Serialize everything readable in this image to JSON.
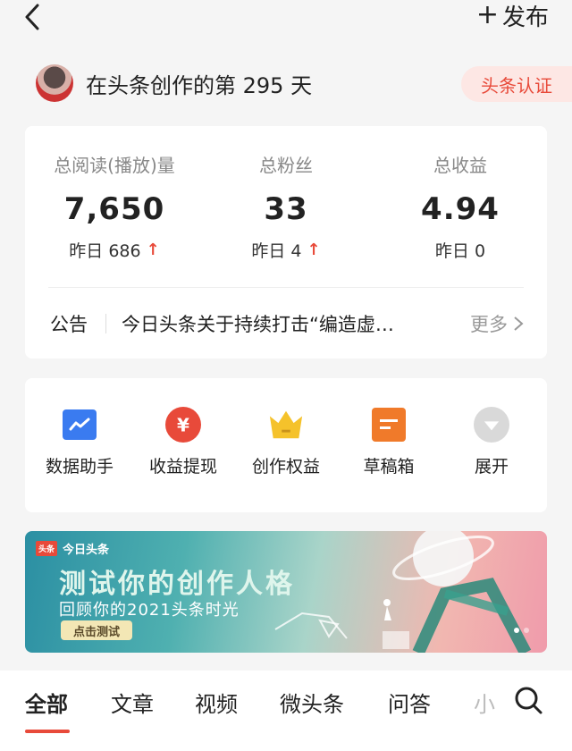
{
  "header": {
    "publish_label": "发布"
  },
  "creator": {
    "days_text": "在头条创作的第 295 天",
    "badge": "头条认证"
  },
  "stats": [
    {
      "label": "总阅读(播放)量",
      "value": "7,650",
      "yesterday": "昨日 686",
      "trend_up": true
    },
    {
      "label": "总粉丝",
      "value": "33",
      "yesterday": "昨日 4",
      "trend_up": true
    },
    {
      "label": "总收益",
      "value": "4.94",
      "yesterday": "昨日 0",
      "trend_up": false
    }
  ],
  "notice": {
    "label": "公告",
    "text": "今日头条关于持续打击“编造虚…",
    "more": "更多"
  },
  "tools": [
    {
      "label": "数据助手",
      "icon": "chart-icon",
      "color": "#3a7bf0"
    },
    {
      "label": "收益提现",
      "icon": "yuan-icon",
      "color": "#e84a3a"
    },
    {
      "label": "创作权益",
      "icon": "crown-icon",
      "color": "#f5c22b"
    },
    {
      "label": "草稿箱",
      "icon": "draft-icon",
      "color": "#f07a2a"
    },
    {
      "label": "展开",
      "icon": "expand-icon",
      "color": "#cccccc"
    }
  ],
  "banner": {
    "brand": "今日头条",
    "brand_logo": "头条",
    "title": "测试你的创作人格",
    "subtitle": "回顾你的2021头条时光",
    "button": "点击测试"
  },
  "tabs": [
    "全部",
    "文章",
    "视频",
    "微头条",
    "问答",
    "小"
  ],
  "colors": {
    "accent": "#e84a3a",
    "badge_bg": "#fde7e4"
  }
}
